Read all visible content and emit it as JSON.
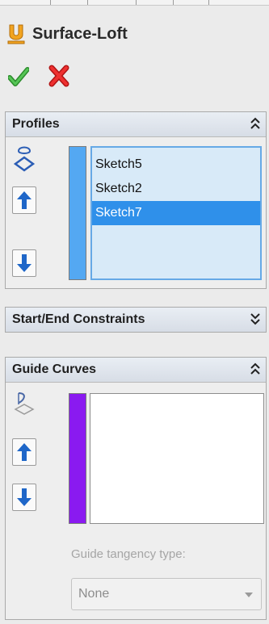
{
  "feature": {
    "title": "Surface-Loft"
  },
  "actions": {
    "ok": "confirm",
    "cancel": "cancel"
  },
  "sections": {
    "profiles": {
      "title": "Profiles",
      "items": [
        "Sketch5",
        "Sketch2",
        "Sketch7"
      ],
      "selected_index": 2,
      "color": "#54a8f2"
    },
    "start_end": {
      "title": "Start/End Constraints",
      "state": "collapsed"
    },
    "guide_curves": {
      "title": "Guide Curves",
      "color": "#8a1af0",
      "tangency_label": "Guide tangency type:",
      "tangency_value": "None"
    }
  },
  "colors": {
    "accent_blue": "#2f90ea",
    "ok_green": "#38a838",
    "cancel_red": "#e02a2a",
    "arrow_blue": "#1e66c8",
    "icon_orange": "#f2a420"
  },
  "icons": [
    "loft-icon",
    "checkmark-icon",
    "x-icon",
    "profile-icon",
    "up-arrow-icon",
    "down-arrow-icon",
    "guide-curve-icon",
    "chevron-icon"
  ]
}
